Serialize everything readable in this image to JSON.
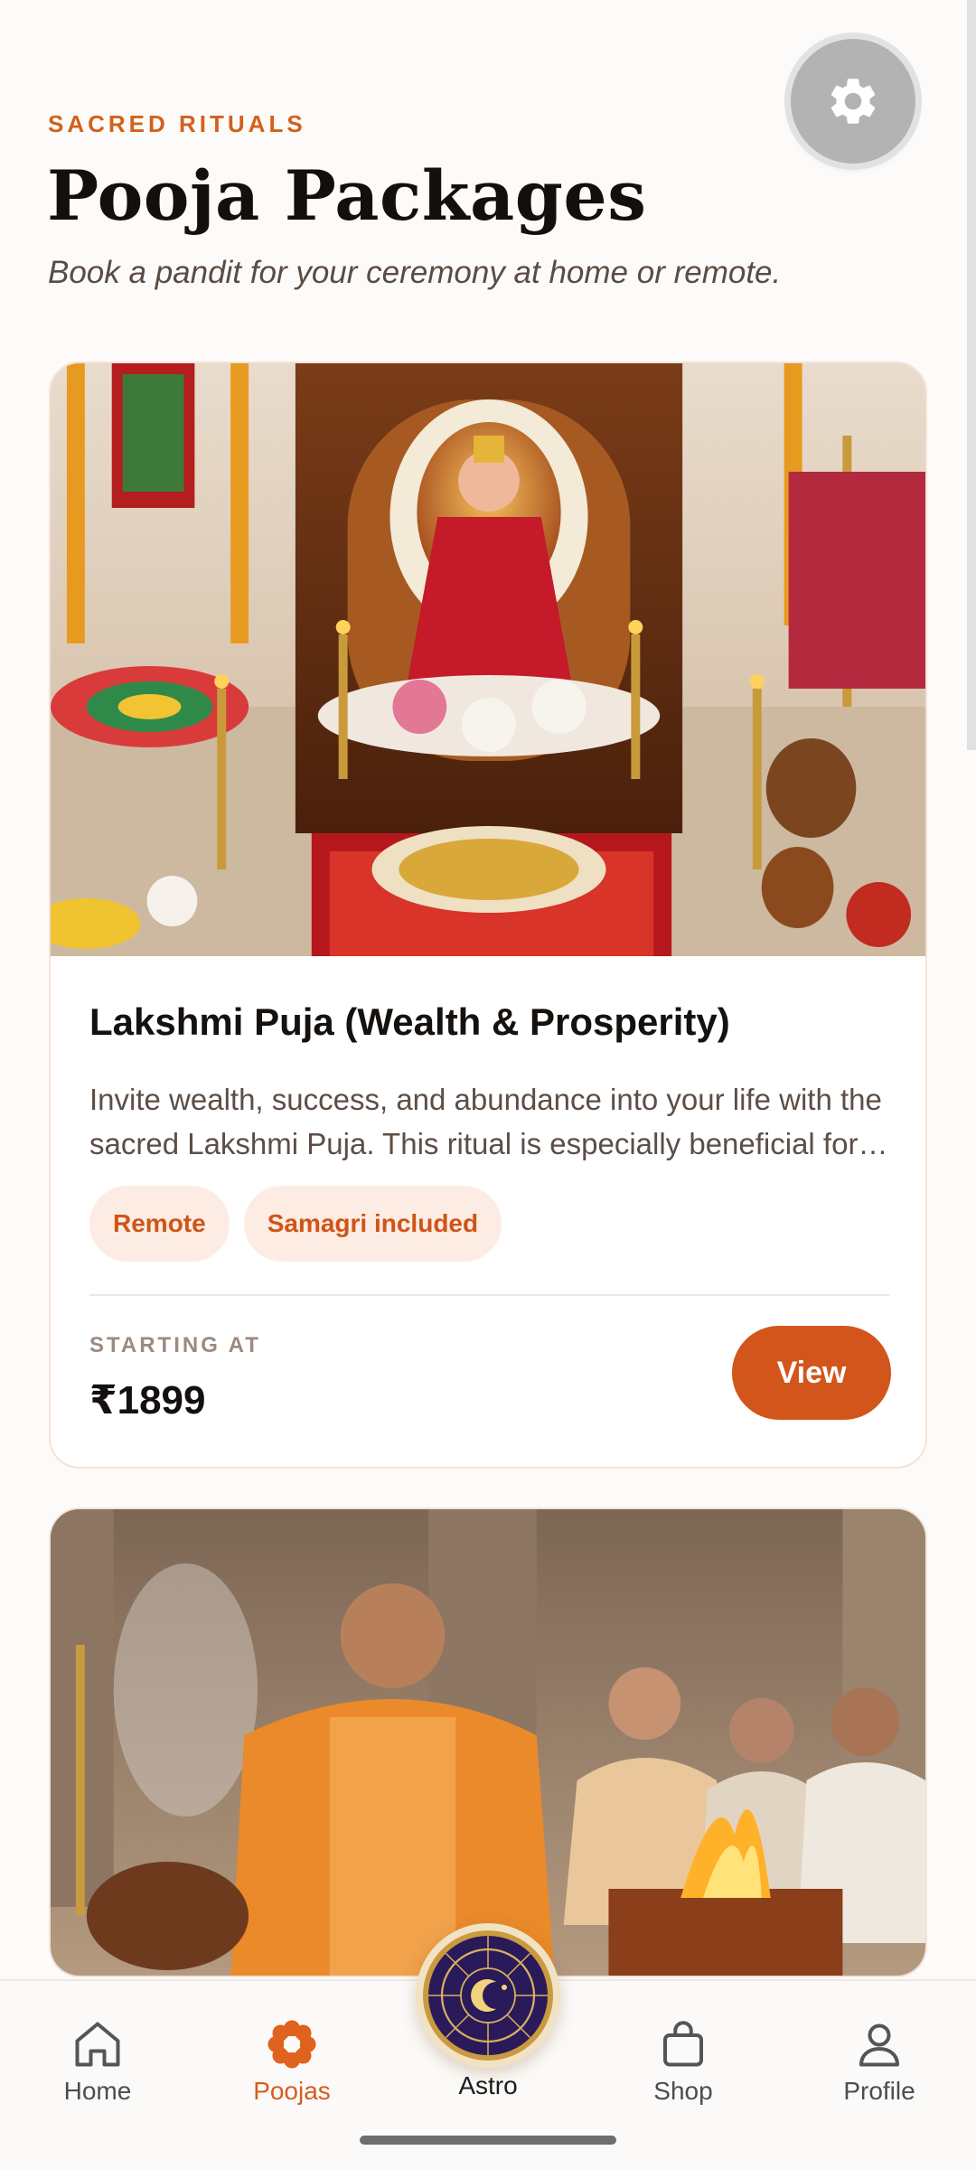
{
  "header": {
    "eyebrow": "SACRED RITUALS",
    "title": "Pooja Packages",
    "subtitle": "Book a pandit for your ceremony at home or remote."
  },
  "settings": {
    "icon": "gear-icon"
  },
  "packages": [
    {
      "image": "lakshmi-puja-altar",
      "title": "Lakshmi Puja (Wealth & Prosperity)",
      "description": "Invite wealth, success, and abundance into your life with the sacred Lakshmi Puja. This ritual is especially beneficial for those seeking financial stability and prosperity.",
      "tags": [
        "Remote",
        "Samagri included"
      ],
      "starting_label": "STARTING AT",
      "price": "₹1899",
      "action_label": "View"
    },
    {
      "image": "havan-ceremony-pandit"
    }
  ],
  "bottom_nav": {
    "items": [
      {
        "label": "Home",
        "icon": "home-icon"
      },
      {
        "label": "Poojas",
        "icon": "flower-icon",
        "active": true
      },
      {
        "label": "Astro",
        "icon": "zodiac-wheel-icon"
      },
      {
        "label": "Shop",
        "icon": "shopping-bag-icon"
      },
      {
        "label": "Profile",
        "icon": "person-icon"
      }
    ]
  },
  "colors": {
    "accent": "#d2561b",
    "tag_bg": "#fdece3",
    "background": "#fdfbf9"
  }
}
